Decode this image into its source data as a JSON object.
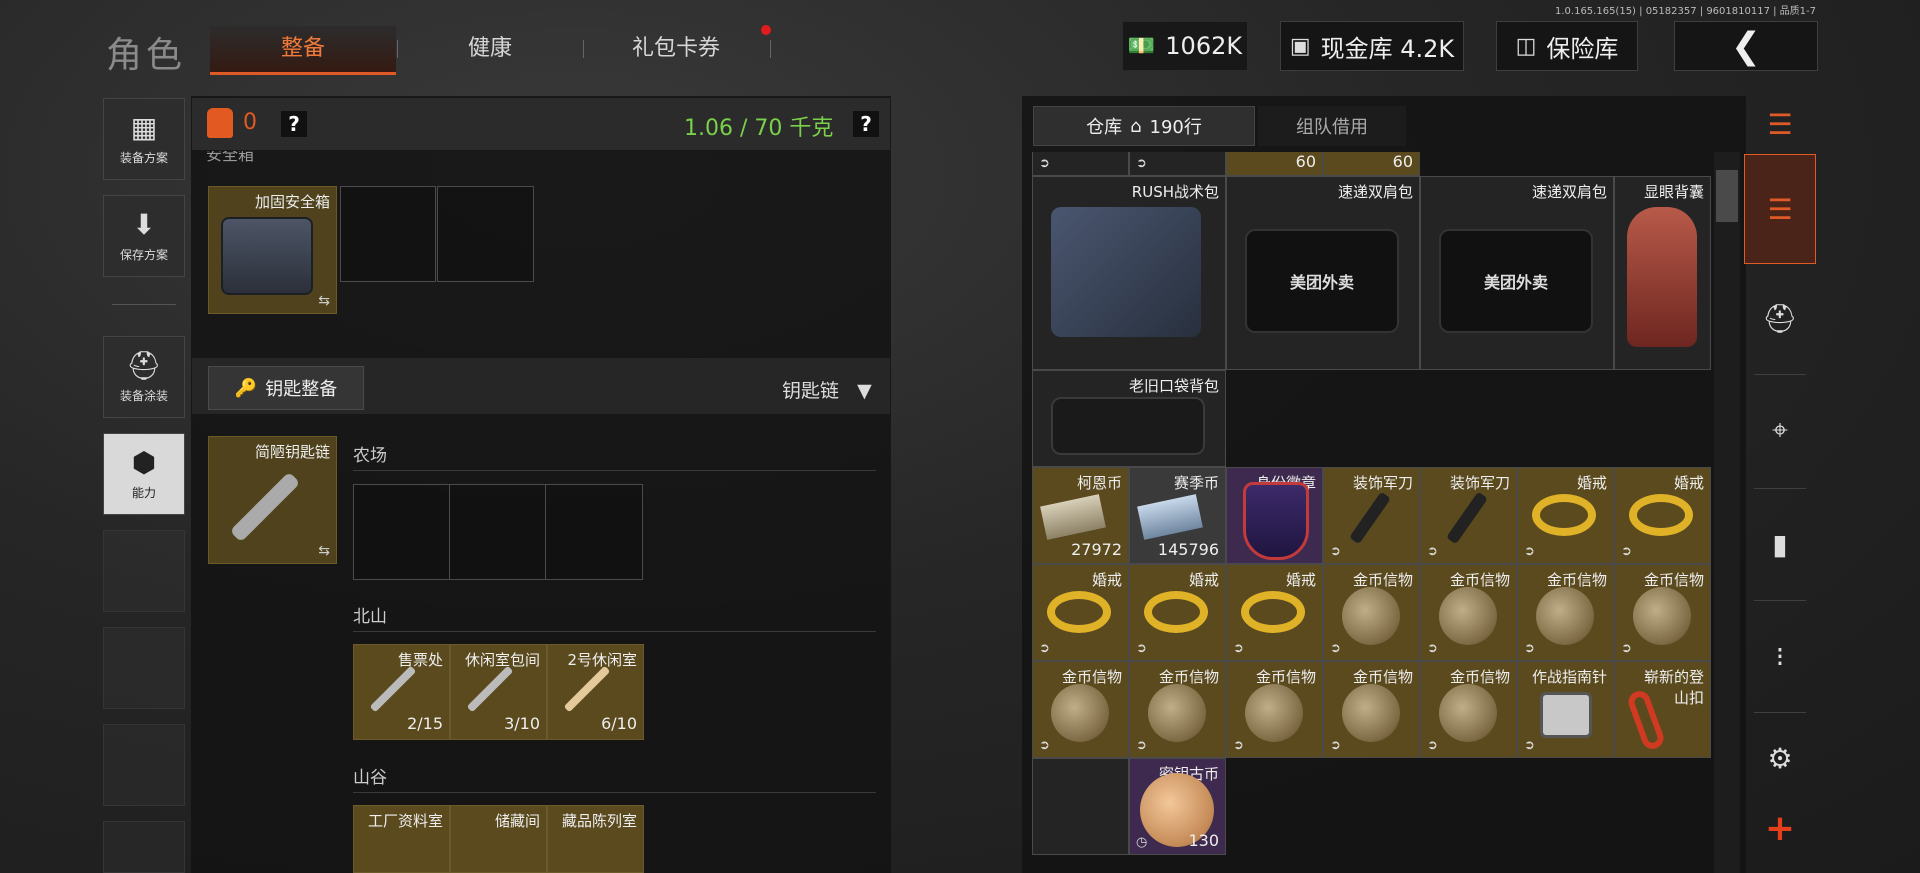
{
  "version_text": "1.0.165.165(15) | 05182357 | 9601810117 | 品质1-7",
  "page_title": "角色",
  "tabs": [
    {
      "label": "整备",
      "active": true
    },
    {
      "label": "健康",
      "active": false
    },
    {
      "label": "礼包卡券",
      "active": false,
      "notification": true
    }
  ],
  "header": {
    "cash": "1062K",
    "cash_vault": "现金库 4.2K",
    "insurance": "保险库",
    "back_icon": "chevron-left-icon"
  },
  "sidebar": [
    {
      "label": "装备方案",
      "icon": "vest-icon"
    },
    {
      "label": "保存方案",
      "icon": "download-icon"
    },
    {
      "label": "装备涂装",
      "icon": "helmet-icon"
    },
    {
      "label": "能力",
      "icon": "hex-bolt-icon"
    }
  ],
  "loadout": {
    "armor_count": "0",
    "help": "?",
    "weight": "1.06 / 70 千克",
    "safe_box_header": "安全箱",
    "safe_box_item": "加固安全箱",
    "key_button": "钥匙整备",
    "keychain_select": "钥匙链",
    "keychain_item": "简陋钥匙链",
    "sections": [
      {
        "name": "农场",
        "keys": []
      },
      {
        "name": "北山",
        "keys": [
          {
            "name": "售票处",
            "count": "2/15"
          },
          {
            "name": "休闲室包间",
            "count": "3/10"
          },
          {
            "name": "2号休闲室",
            "count": "6/10"
          }
        ]
      },
      {
        "name": "山谷",
        "keys": [
          {
            "name": "工厂资料室"
          },
          {
            "name": "储藏间"
          },
          {
            "name": "藏品陈列室"
          }
        ]
      }
    ]
  },
  "warehouse": {
    "tab_storage": "仓库",
    "rows": "190行",
    "tab_team": "组队借用",
    "top_counts": [
      "60",
      "60"
    ],
    "bags": [
      "RUSH战术包",
      "速递双肩包",
      "速递双肩包",
      "显眼背囊",
      "老旧口袋背包"
    ],
    "row3": [
      {
        "name": "柯恩币",
        "count": "27972"
      },
      {
        "name": "赛季币",
        "count": "145796"
      },
      {
        "name": "身份徽章"
      },
      {
        "name": "装饰军刀"
      },
      {
        "name": "装饰军刀"
      },
      {
        "name": "婚戒"
      },
      {
        "name": "婚戒"
      }
    ],
    "row4": [
      "婚戒",
      "婚戒",
      "婚戒",
      "金币信物",
      "金币信物",
      "金币信物",
      "金币信物"
    ],
    "row5": [
      "金币信物",
      "金币信物",
      "金币信物",
      "金币信物",
      "金币信物",
      "作战指南针",
      "崭新的登山扣"
    ],
    "row6": [
      {
        "name": "密钥古币",
        "count": "130"
      }
    ],
    "bag_print": "美团外卖"
  },
  "right_tabs": [
    "sort-icon",
    "stack-icon",
    "helmet-icon",
    "rifle-icon",
    "magazine-icon",
    "ammo-icon",
    "gear-icon",
    "add-icon"
  ]
}
